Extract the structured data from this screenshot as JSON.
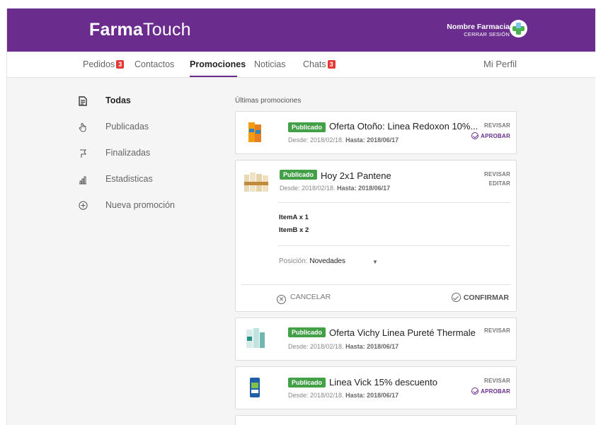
{
  "app": {
    "brand_bold": "Farma",
    "brand_light": "Touch"
  },
  "header": {
    "pharmacy_name": "Nombre Farmacia",
    "logout": "CERRAR SESIÓN"
  },
  "nav": {
    "pedidos": {
      "label": "Pedidos",
      "badge": "3"
    },
    "contactos": {
      "label": "Contactos"
    },
    "promociones": {
      "label": "Promociones"
    },
    "noticias": {
      "label": "Noticias"
    },
    "chats": {
      "label": "Chats",
      "badge": "3"
    },
    "profile": "Mi Perfil"
  },
  "sidebar": {
    "items": [
      {
        "label": "Todas",
        "icon": "document-icon"
      },
      {
        "label": "Publicadas",
        "icon": "hand-pointer-icon"
      },
      {
        "label": "Finalizadas",
        "icon": "flag-icon"
      },
      {
        "label": "Estadisticas",
        "icon": "chart-icon"
      },
      {
        "label": "Nueva promoción",
        "icon": "plus-circle-icon"
      }
    ]
  },
  "main": {
    "section_title": "Últimas promociones",
    "promos": [
      {
        "status": "Publicado",
        "title": "Oferta Otoño: Linea Redoxon 10%...",
        "from_label": "Desde: 2018/02/18.",
        "to_label": "Hasta: 2018/06/17",
        "action1": "REVISAR",
        "action2": "APROBAR"
      },
      {
        "status": "Publicado",
        "title": "Hoy 2x1 Pantene",
        "from_label": "Desde: 2018/02/18.",
        "to_label": "Hasta: 2018/06/17",
        "action1": "REVISAR",
        "action2": "EDITAR",
        "items": [
          "ItemA x 1",
          "ItemB x 2"
        ],
        "position_label": "Posición:",
        "position_value": "Novedades",
        "cancel": "CANCELAR",
        "confirm": "CONFIRMAR"
      },
      {
        "status": "Publicado",
        "title": "Oferta Vichy Linea Pureté Thermale",
        "from_label": "Desde: 2018/02/18.",
        "to_label": "Hasta: 2018/06/17",
        "action1": "REVISAR"
      },
      {
        "status": "Publicado",
        "title": "Linea Vick 15% descuento",
        "from_label": "Desde: 2018/02/18.",
        "to_label": "Hasta: 2018/06/17",
        "action1": "REVISAR",
        "action2": "APROBAR"
      }
    ]
  },
  "colors": {
    "brand": "#6a2c8d",
    "published": "#43a047",
    "badge": "#e53935"
  }
}
